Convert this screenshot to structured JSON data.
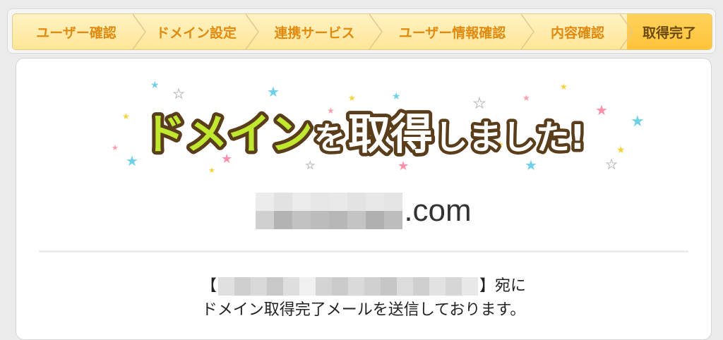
{
  "steps": [
    {
      "label": "ユーザー確認",
      "active": false
    },
    {
      "label": "ドメイン設定",
      "active": false
    },
    {
      "label": "連携サービス",
      "active": false
    },
    {
      "label": "ユーザー情報確認",
      "active": false
    },
    {
      "label": "内容確認",
      "active": false
    },
    {
      "label": "取得完了",
      "active": true
    }
  ],
  "banner": {
    "part1": "ドメイン",
    "part2": "を",
    "part3": "取得",
    "part4": "しました!"
  },
  "domain": {
    "suffix": ".com"
  },
  "message": {
    "open_bracket": "【",
    "close_bracket": "】宛に",
    "line2": "ドメイン取得完了メールを送信しております。"
  },
  "colors": {
    "step_text": "#e08a10",
    "active_step": "#ffc33a",
    "banner_green": "#b8e52a",
    "banner_outline": "#5a3d1a"
  }
}
